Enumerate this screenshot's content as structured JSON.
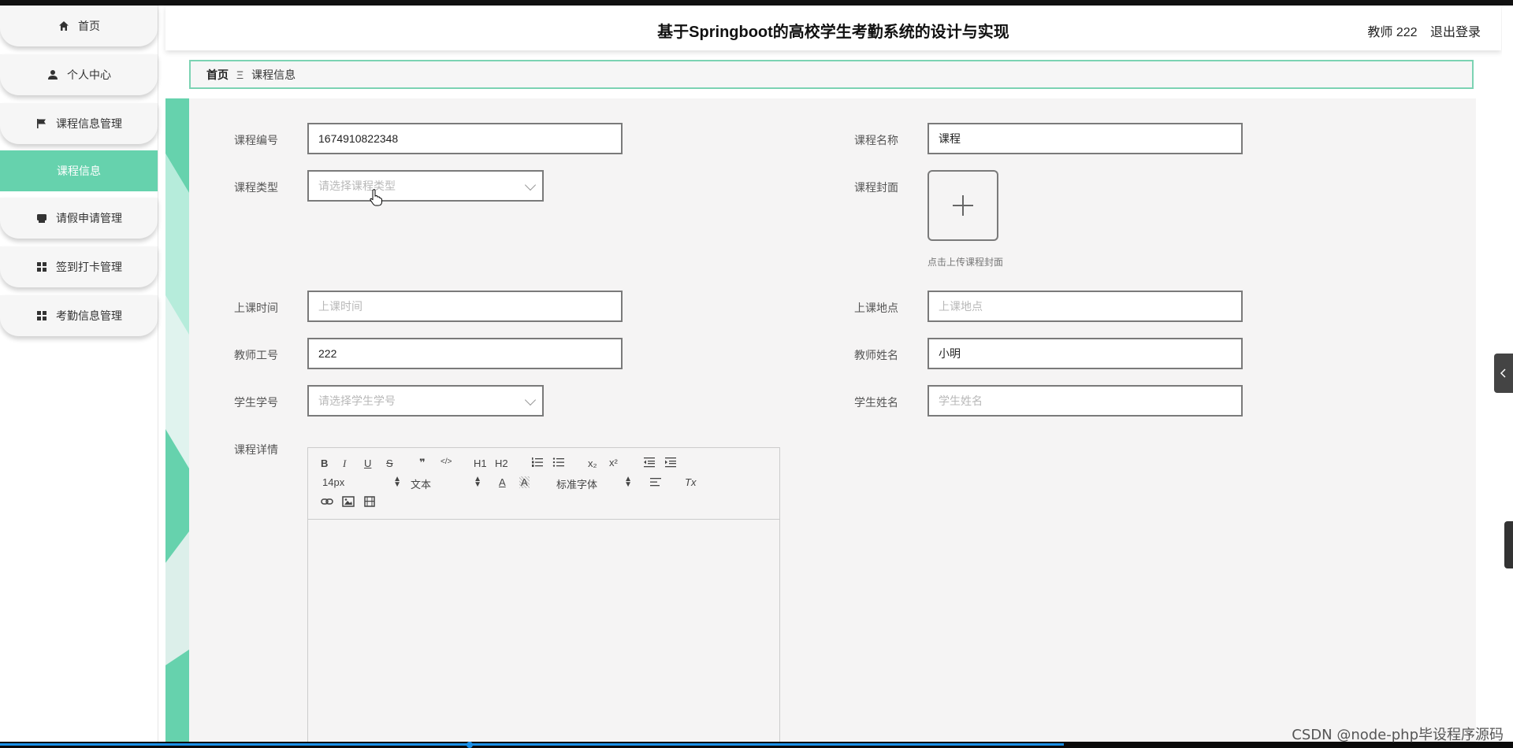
{
  "app": {
    "title": "基于Springboot的高校学生考勤系统的设计与实现",
    "user_label": "教师 222",
    "logout_label": "退出登录"
  },
  "sidebar": {
    "items": [
      {
        "label": "首页",
        "icon": "home-icon"
      },
      {
        "label": "个人中心",
        "icon": "user-icon"
      },
      {
        "label": "课程信息管理",
        "icon": "flag-icon"
      },
      {
        "label": "课程信息",
        "icon": "",
        "active": true
      },
      {
        "label": "请假申请管理",
        "icon": "printer-icon"
      },
      {
        "label": "签到打卡管理",
        "icon": "grid-icon"
      },
      {
        "label": "考勤信息管理",
        "icon": "grid-icon"
      }
    ]
  },
  "breadcrumb": {
    "home": "首页",
    "separator": "Ξ",
    "current": "课程信息"
  },
  "form": {
    "course_no": {
      "label": "课程编号",
      "value": "1674910822348"
    },
    "course_name": {
      "label": "课程名称",
      "value": "课程"
    },
    "course_type": {
      "label": "课程类型",
      "placeholder": "请选择课程类型"
    },
    "cover": {
      "label": "课程封面",
      "hint": "点击上传课程封面",
      "plus": "+"
    },
    "class_time": {
      "label": "上课时间",
      "placeholder": "上课时间"
    },
    "class_place": {
      "label": "上课地点",
      "placeholder": "上课地点"
    },
    "teacher_no": {
      "label": "教师工号",
      "value": "222"
    },
    "teacher_name": {
      "label": "教师姓名",
      "value": "小明"
    },
    "student_no": {
      "label": "学生学号",
      "placeholder": "请选择学生学号"
    },
    "student_name": {
      "label": "学生姓名",
      "placeholder": "学生姓名"
    },
    "detail": {
      "label": "课程详情"
    }
  },
  "editor": {
    "font_size": "14px",
    "header_select": "文本",
    "font_family": "标准字体",
    "buttons": {
      "bold": "B",
      "italic": "I",
      "underline": "U",
      "strike": "S",
      "quote": "❞",
      "code": "</>",
      "h1": "H1",
      "h2": "H2",
      "sub": "x₂",
      "sup": "x²",
      "clean": "Tx",
      "color": "A",
      "background": "A"
    }
  },
  "watermark": "CSDN @node-php毕设程序源码",
  "colors": {
    "accent": "#66d2ad",
    "breadcrumb_border": "#7cd3b3",
    "content_bg": "#f5f4f4"
  }
}
